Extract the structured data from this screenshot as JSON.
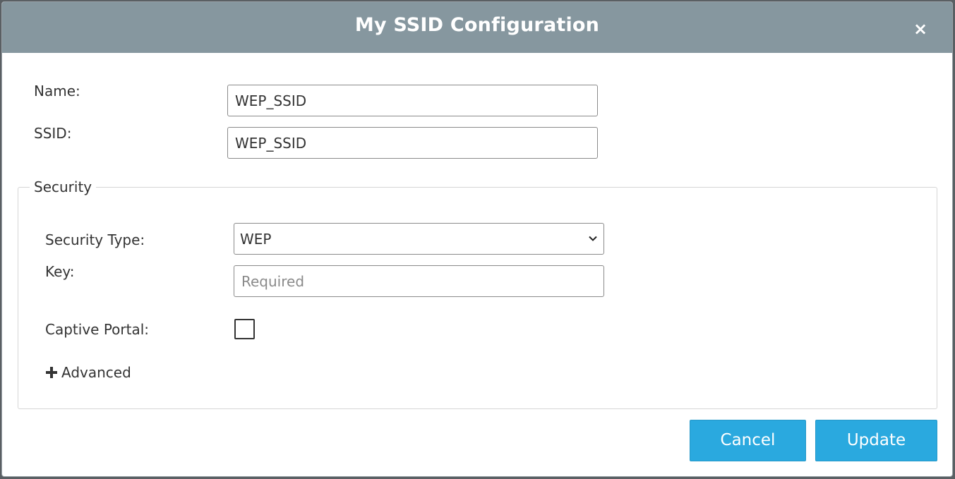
{
  "dialog": {
    "title": "My SSID Configuration",
    "close_label": "×"
  },
  "form": {
    "name_label": "Name:",
    "name_value": "WEP_SSID",
    "ssid_label": "SSID:",
    "ssid_value": "WEP_SSID"
  },
  "security": {
    "legend": "Security",
    "type_label": "Security Type:",
    "type_value": "WEP",
    "key_label": "Key:",
    "key_value": "",
    "key_placeholder": "Required",
    "captive_portal_label": "Captive Portal:",
    "captive_portal_checked": false,
    "advanced_label": "Advanced"
  },
  "buttons": {
    "cancel": "Cancel",
    "update": "Update"
  },
  "colors": {
    "header_bg": "#86979f",
    "button_bg": "#2aa9df"
  },
  "icons": {
    "close": "close-icon",
    "chevron": "chevron-down-icon",
    "plus": "plus-icon"
  }
}
